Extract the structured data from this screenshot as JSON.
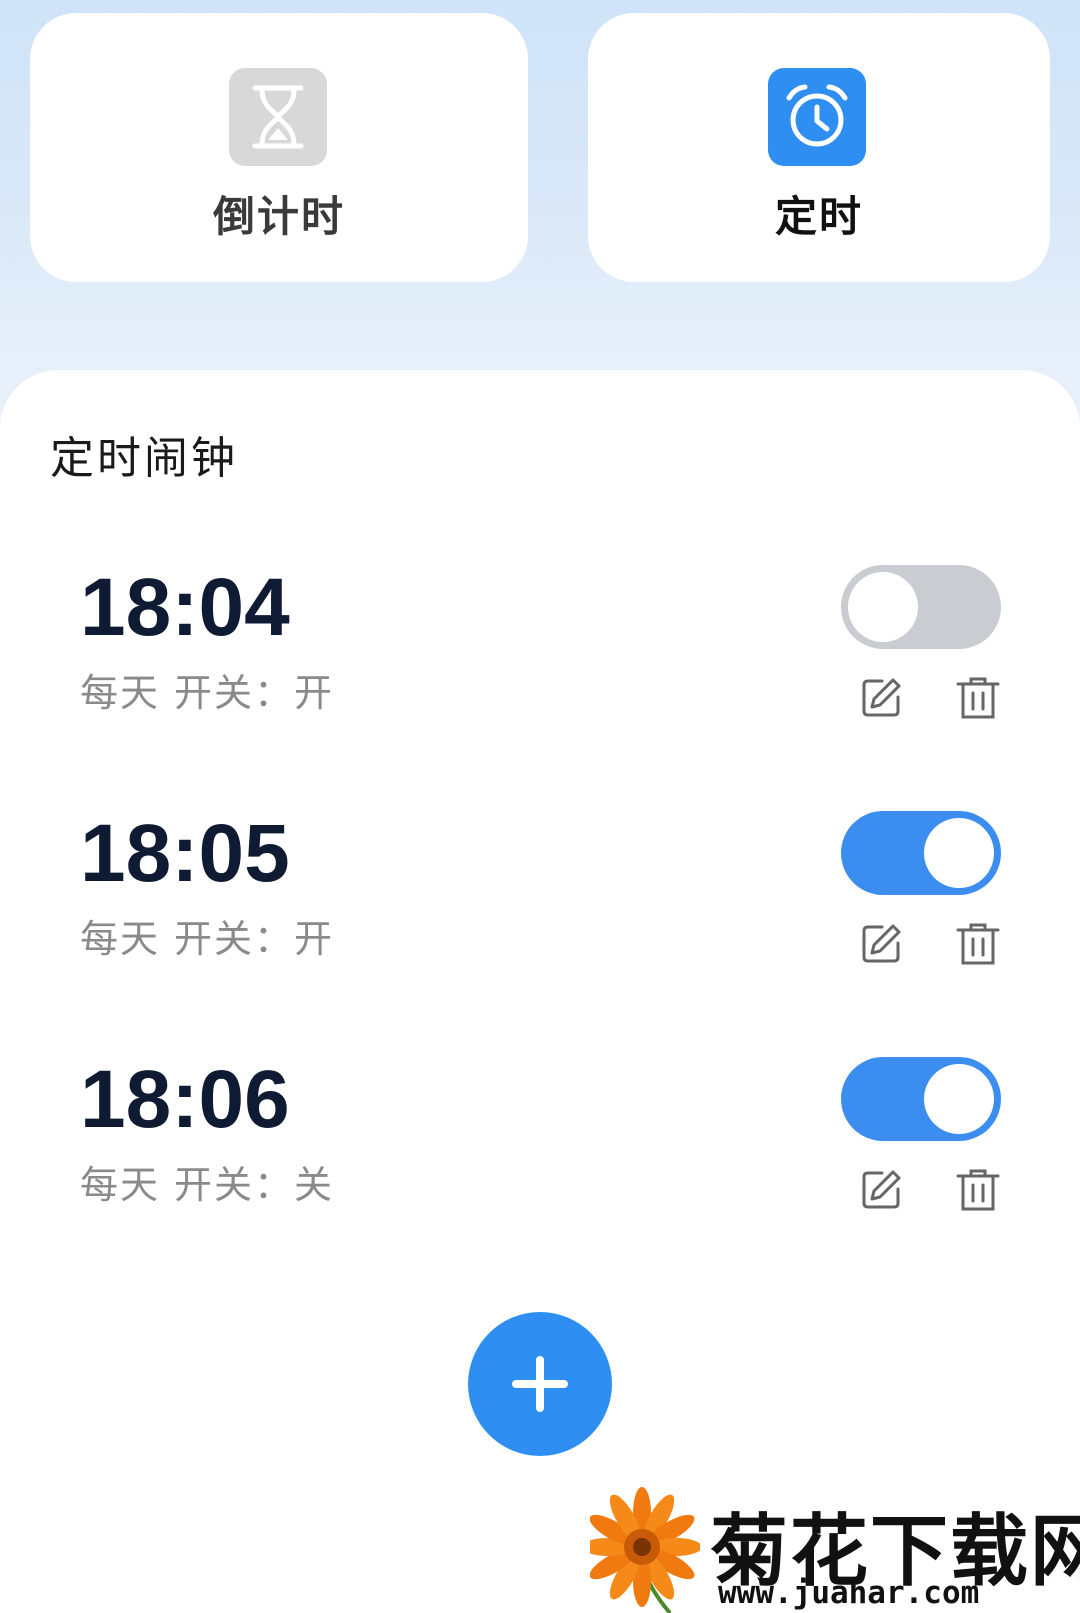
{
  "mode_tabs": [
    {
      "label": "倒计时",
      "icon": "hourglass-icon",
      "selected": false,
      "icon_bg": "#d8d8d8"
    },
    {
      "label": "定时",
      "icon": "alarm-clock-icon",
      "selected": true,
      "icon_bg": "#2f8ef1"
    }
  ],
  "alarm_section": {
    "title": "定时闹钟",
    "alarms": [
      {
        "time": "18:04",
        "repeat": "每天",
        "switch_label": "开关：",
        "switch_state": "开",
        "toggle_on": false
      },
      {
        "time": "18:05",
        "repeat": "每天",
        "switch_label": "开关：",
        "switch_state": "开",
        "toggle_on": true
      },
      {
        "time": "18:06",
        "repeat": "每天",
        "switch_label": "开关：",
        "switch_state": "关",
        "toggle_on": true
      }
    ],
    "row_actions": [
      "edit-icon",
      "delete-icon"
    ]
  },
  "add_button": {
    "icon": "plus-icon",
    "color": "#2f8ef1"
  },
  "watermark": {
    "title": "菊花下载网",
    "url": "www.juahar.com"
  },
  "colors": {
    "accent": "#2f8ef1",
    "toggle_on": "#3b8ef0",
    "toggle_off": "#c9ccd1",
    "time_text": "#0f1a33",
    "meta_text": "#8a8a8a"
  }
}
